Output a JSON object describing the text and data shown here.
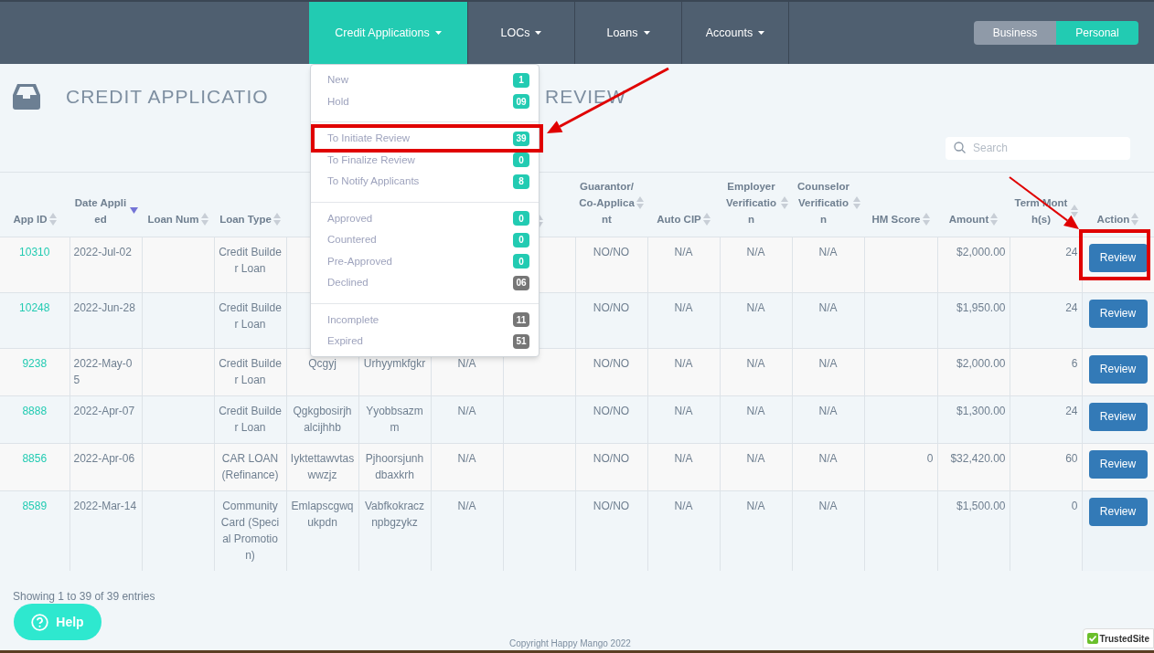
{
  "nav": {
    "items": [
      {
        "label": "Credit Applications",
        "selected": true
      },
      {
        "label": "LOCs",
        "selected": false
      },
      {
        "label": "Loans",
        "selected": false
      },
      {
        "label": "Accounts",
        "selected": false
      }
    ],
    "toggle": [
      {
        "label": "Business",
        "selected": false
      },
      {
        "label": "Personal",
        "selected": true
      }
    ]
  },
  "dropdown": {
    "groups": [
      {
        "items": [
          {
            "label": "New",
            "count": "1",
            "color": "#22cbb2"
          },
          {
            "label": "Hold",
            "count": "09",
            "color": "#22cbb2"
          }
        ]
      },
      {
        "items": [
          {
            "label": "To Initiate Review",
            "count": "39",
            "color": "#22cbb2"
          },
          {
            "label": "To Finalize Review",
            "count": "0",
            "color": "#22cbb2"
          },
          {
            "label": "To Notify Applicants",
            "count": "8",
            "color": "#22cbb2"
          }
        ]
      },
      {
        "items": [
          {
            "label": "Approved",
            "count": "0",
            "color": "#22cbb2"
          },
          {
            "label": "Countered",
            "count": "0",
            "color": "#22cbb2"
          },
          {
            "label": "Pre-Approved",
            "count": "0",
            "color": "#22cbb2"
          },
          {
            "label": "Declined",
            "count": "06",
            "color": "#767676"
          }
        ]
      },
      {
        "items": [
          {
            "label": "Incomplete",
            "count": "11",
            "color": "#767676"
          },
          {
            "label": "Expired",
            "count": "51",
            "color": "#767676"
          }
        ]
      }
    ]
  },
  "page": {
    "title_start": "CREDIT APPLICATIO",
    "title_end": "REVIEW"
  },
  "search": {
    "placeholder": "Search"
  },
  "table": {
    "columns": [
      {
        "label": "App ID",
        "sorted": false
      },
      {
        "label": "Date Applied",
        "sorted": true
      },
      {
        "label": "Loan Num",
        "sorted": false
      },
      {
        "label": "Loan Type",
        "sorted": false
      },
      {},
      {},
      {},
      {
        "sorted": false
      },
      {
        "label": "Guarantor/ Co-Applicant",
        "sorted": false
      },
      {
        "label": "Auto CIP",
        "sorted": false
      },
      {
        "label": "Employer Verification",
        "sorted": false
      },
      {
        "label": "Counselor Verification",
        "sorted": false
      },
      {
        "label": "HM Score",
        "sorted": false
      },
      {
        "label": "Amount",
        "sorted": false
      },
      {
        "label": "Term Month(s)",
        "sorted": false
      },
      {
        "label": "Action",
        "sorted": false
      }
    ],
    "rows": [
      {
        "cells": [
          "10310",
          "2022-Jul-02",
          "",
          "Credit Builder Loan",
          "",
          "",
          "",
          "",
          "NO/NO",
          "N/A",
          "N/A",
          "N/A",
          "",
          "$2,000.00",
          "24"
        ],
        "action": "Review"
      },
      {
        "cells": [
          "10248",
          "2022-Jun-28",
          "",
          "Credit Builder Loan",
          "",
          "",
          "",
          "",
          "NO/NO",
          "N/A",
          "N/A",
          "N/A",
          "",
          "$1,950.00",
          "24"
        ],
        "action": "Review"
      },
      {
        "cells": [
          "9238",
          "2022-May-05",
          "",
          "Credit Builder Loan",
          "Qcgyj",
          "Urhyymkfgkr",
          "N/A",
          "",
          "NO/NO",
          "N/A",
          "N/A",
          "N/A",
          "",
          "$2,000.00",
          "6"
        ],
        "action": "Review"
      },
      {
        "cells": [
          "8888",
          "2022-Apr-07",
          "",
          "Credit Builder Loan",
          "Qgkgbosirjhalcijhhb",
          "Yyobbsazmm",
          "N/A",
          "",
          "NO/NO",
          "N/A",
          "N/A",
          "N/A",
          "",
          "$1,300.00",
          "24"
        ],
        "action": "Review"
      },
      {
        "cells": [
          "8856",
          "2022-Apr-06",
          "",
          "CAR LOAN (Refinance)",
          "Iyktettawvtaswwzjz",
          "Pjhoorsjunhdbaxkrh",
          "N/A",
          "",
          "NO/NO",
          "N/A",
          "N/A",
          "N/A",
          "0",
          "$32,420.00",
          "60"
        ],
        "action": "Review"
      },
      {
        "cells": [
          "8589",
          "2022-Mar-14",
          "",
          "Community Card (Special Promotion)",
          "Emlapscgwqukpdn",
          "Vabfkokracznpbgzykz",
          "N/A",
          "",
          "NO/NO",
          "N/A",
          "N/A",
          "N/A",
          "",
          "$1,500.00",
          "0"
        ],
        "action": "Review"
      }
    ]
  },
  "footer": {
    "showing": "Showing 1 to 39 of 39 entries",
    "help": "Help",
    "copyright": "Copyright Happy Mango 2022",
    "badge": "TrustedSite"
  }
}
